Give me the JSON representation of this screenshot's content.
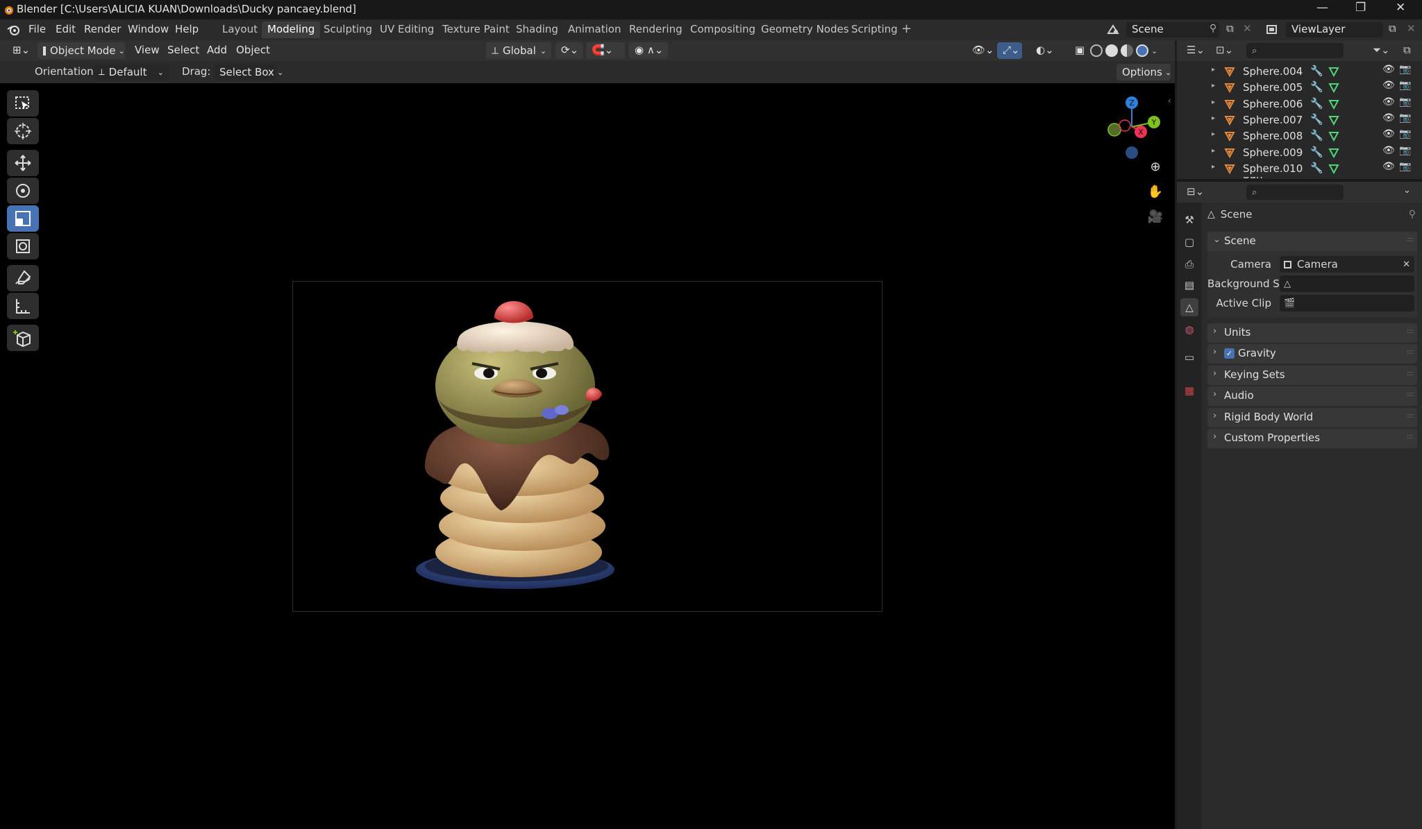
{
  "window": {
    "title": "Blender [C:\\Users\\ALICIA KUAN\\Downloads\\Ducky pancaey.blend]",
    "controls": [
      "—",
      "❐",
      "✕"
    ]
  },
  "menu": [
    "File",
    "Edit",
    "Render",
    "Window",
    "Help"
  ],
  "workspaces": [
    "Layout",
    "Modeling",
    "Sculpting",
    "UV Editing",
    "Texture Paint",
    "Shading",
    "Animation",
    "Rendering",
    "Compositing",
    "Geometry Nodes",
    "Scripting"
  ],
  "active_workspace": "Modeling",
  "scene_field": "Scene",
  "viewlayer_field": "ViewLayer",
  "viewport_header": {
    "mode": "Object Mode",
    "menus": [
      "View",
      "Select",
      "Add",
      "Object"
    ],
    "transform_orientation": "Global"
  },
  "tool_header": {
    "orientation_label": "Orientation:",
    "orientation_value": "Default",
    "drag_label": "Drag:",
    "drag_value": "Select Box",
    "options": "Options"
  },
  "gizmo": {
    "z": "Z",
    "y": "Y",
    "x": "X"
  },
  "outliner": {
    "items": [
      "Sphere.004",
      "Sphere.005",
      "Sphere.006",
      "Sphere.007",
      "Sphere.008",
      "Sphere.009",
      "Sphere.010"
    ],
    "partial_item": "Sun"
  },
  "properties": {
    "header": "Scene",
    "section": "Scene",
    "fields": [
      {
        "label": "Camera",
        "value": "Camera"
      },
      {
        "label": "Background S...",
        "value": ""
      },
      {
        "label": "Active Clip",
        "value": ""
      }
    ],
    "panels": [
      "Units",
      "Gravity",
      "Keying Sets",
      "Audio",
      "Rigid Body World",
      "Custom Properties"
    ],
    "gravity_enabled": true
  },
  "colors": {
    "accent": "#4772b3",
    "axis_x": "#ee3355",
    "axis_y": "#7fc21e",
    "axis_z": "#2f7fdc",
    "object_icon": "#e5893a",
    "modifier_icon": "#5f9cf0",
    "mesh_icon": "#4fd47a"
  }
}
